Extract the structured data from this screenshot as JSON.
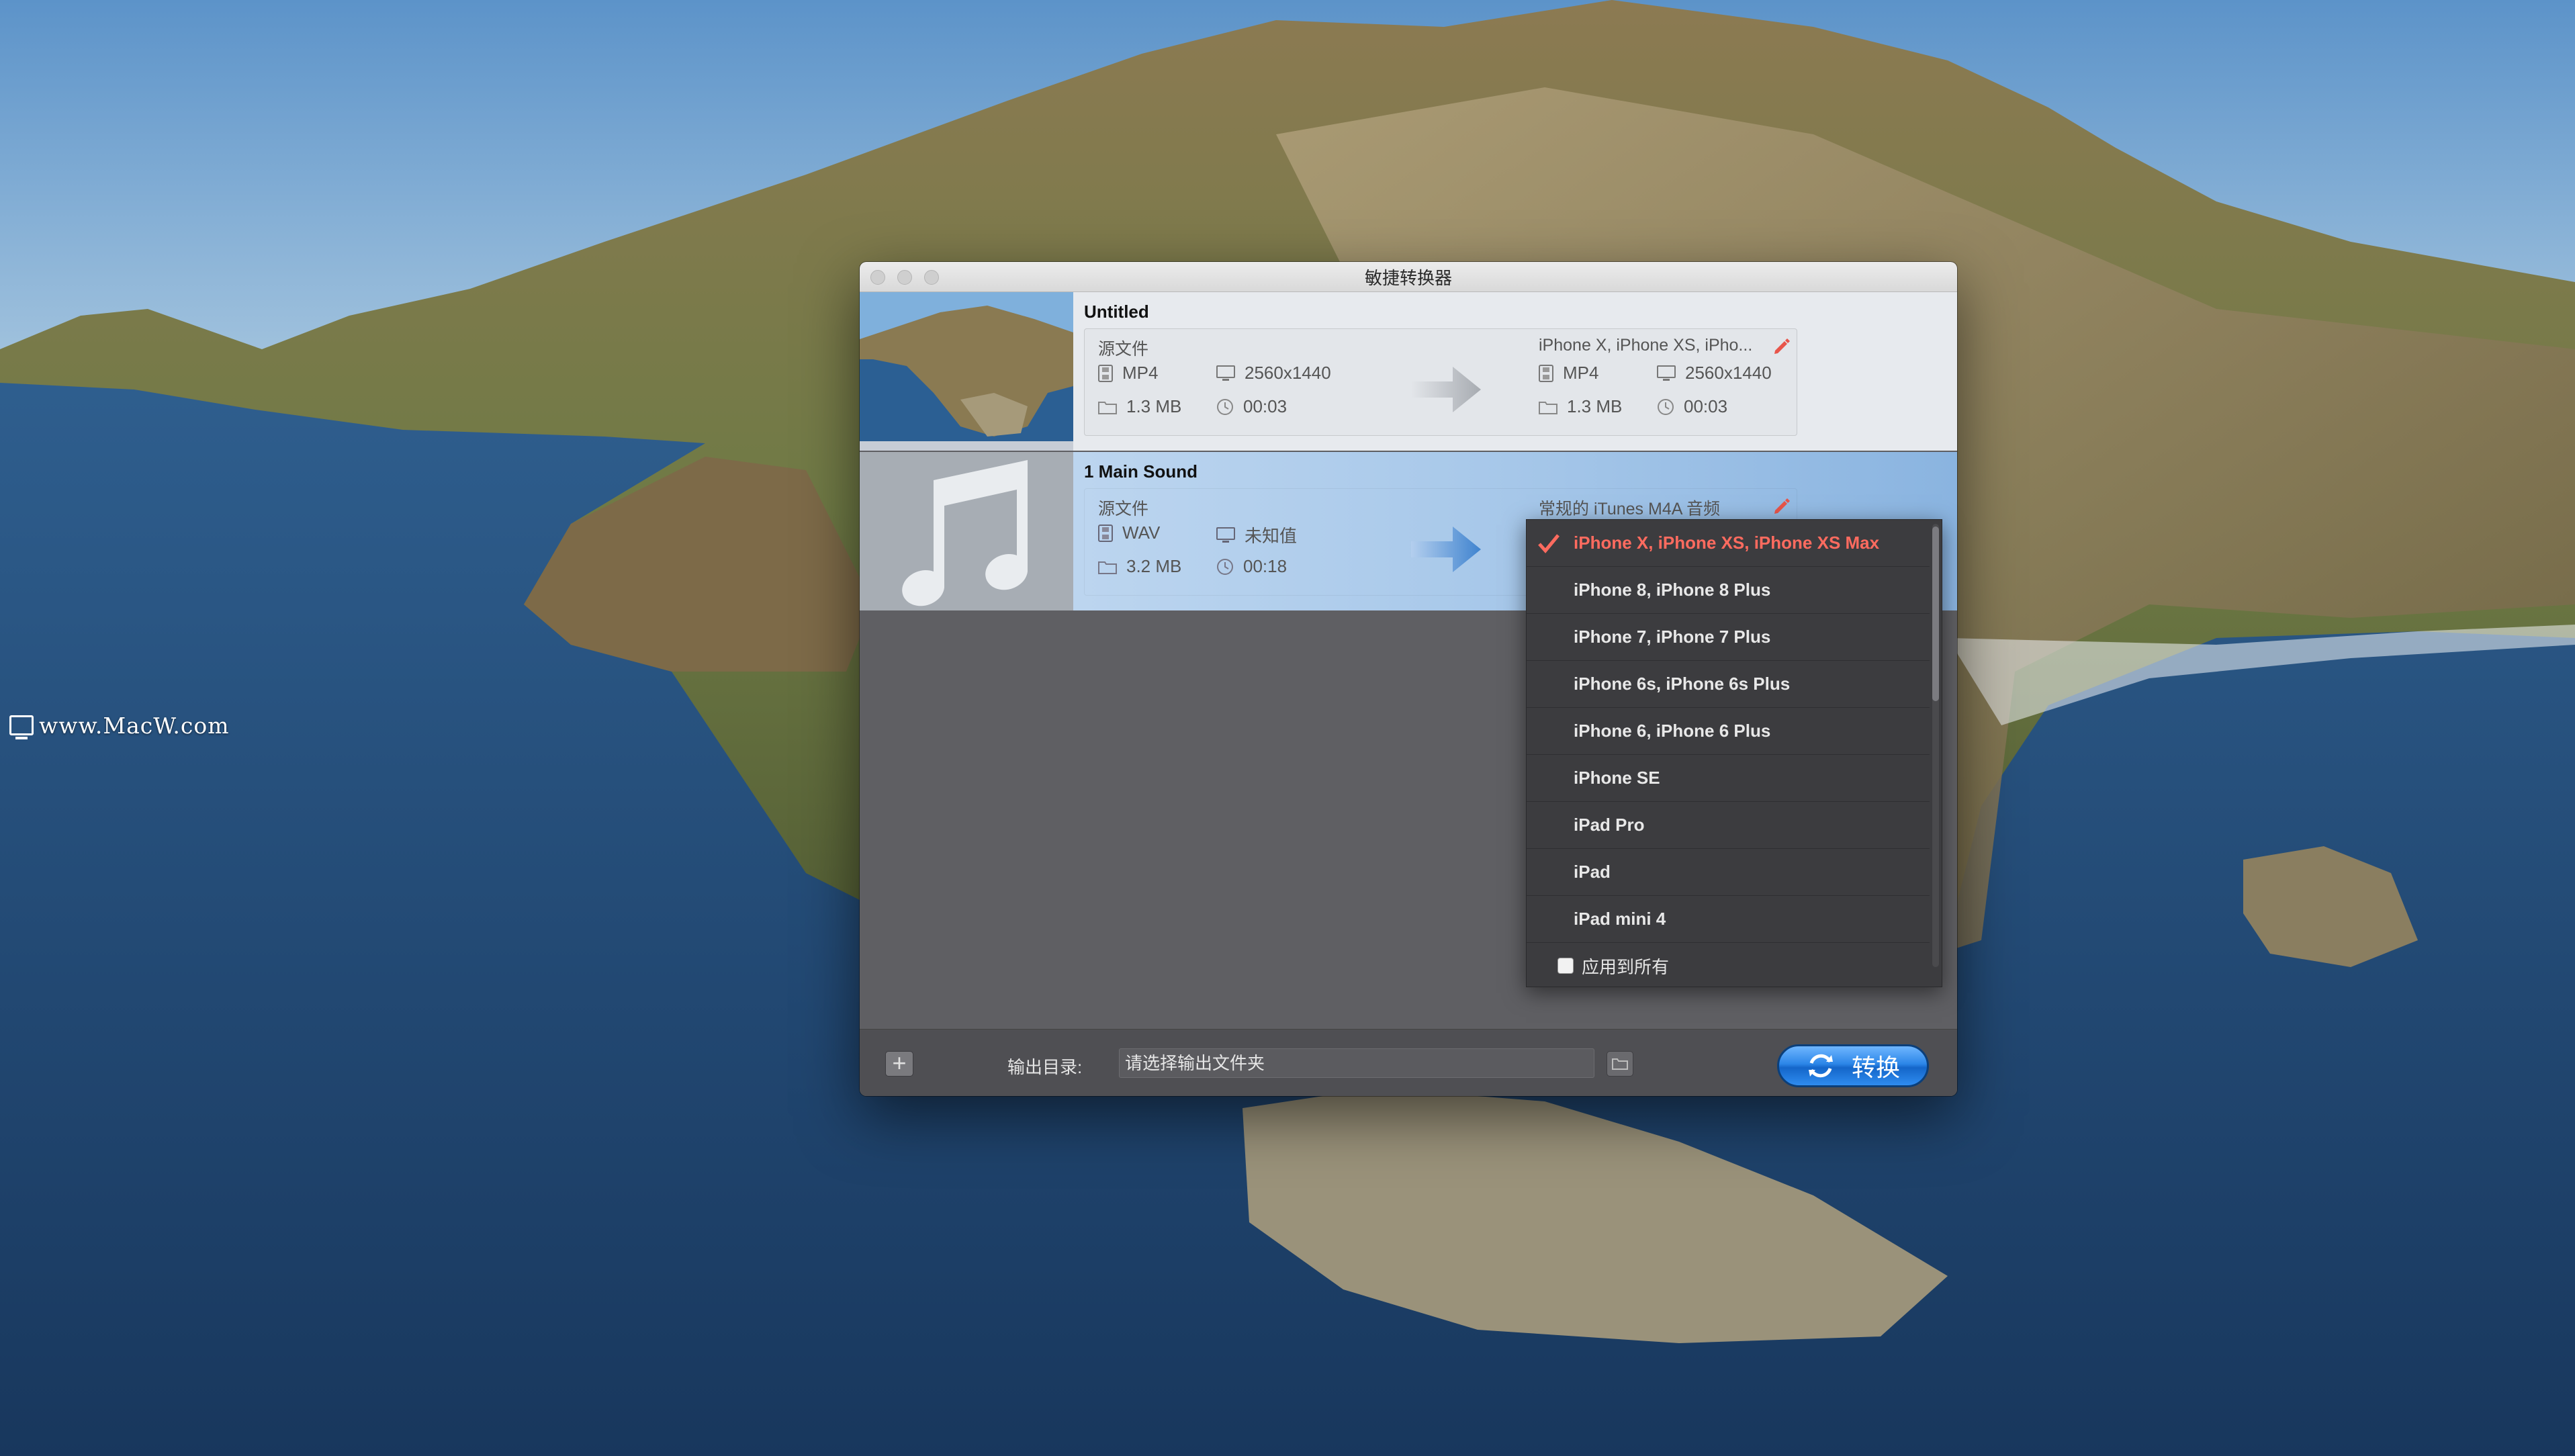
{
  "watermark": "www.MacW.com",
  "window": {
    "title": "敏捷转换器"
  },
  "files": [
    {
      "title": "Untitled",
      "source_label": "源文件",
      "source": {
        "format": "MP4",
        "resolution": "2560x1440",
        "size": "1.3 MB",
        "duration": "00:03"
      },
      "target_label": "iPhone X, iPhone XS, iPho...",
      "target": {
        "format": "MP4",
        "resolution": "2560x1440",
        "size": "1.3 MB",
        "duration": "00:03"
      }
    },
    {
      "title": "1 Main Sound",
      "source_label": "源文件",
      "source": {
        "format": "WAV",
        "resolution": "未知值",
        "size": "3.2 MB",
        "duration": "00:18"
      },
      "target_label": "常规的 iTunes M4A 音频"
    }
  ],
  "preset_menu": {
    "selected": "iPhone X, iPhone XS, iPhone XS Max",
    "items": [
      "iPhone X, iPhone XS, iPhone XS Max",
      "iPhone 8, iPhone 8 Plus",
      "iPhone 7, iPhone 7 Plus",
      "iPhone 6s, iPhone 6s Plus",
      "iPhone 6, iPhone 6 Plus",
      "iPhone SE",
      "iPad Pro",
      "iPad",
      "iPad mini 4"
    ],
    "apply_all_label": "应用到所有"
  },
  "bottom_bar": {
    "add_label": "+",
    "output_label": "输出目录:",
    "output_placeholder": "请选择输出文件夹",
    "convert_label": "转换"
  },
  "colors": {
    "accent": "#2c86e8",
    "selected_item": "#ff6b5f",
    "edit_pencil": "#e8554a"
  }
}
